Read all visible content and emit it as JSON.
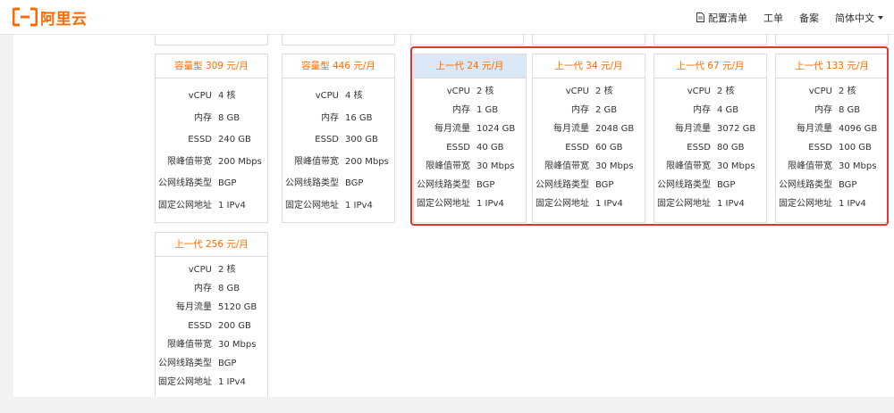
{
  "brand": {
    "logo_text": "阿里云"
  },
  "nav": {
    "config_list": "配置清单",
    "tickets": "工单",
    "filing": "备案",
    "language": "简体中文"
  },
  "cards": [
    {
      "title": "容量型 309 元/月",
      "rows": [
        {
          "k": "vCPU",
          "v": "4 核"
        },
        {
          "k": "内存",
          "v": "8 GB"
        },
        {
          "k": "ESSD",
          "v": "240 GB"
        },
        {
          "k": "限峰值带宽",
          "v": "200 Mbps"
        },
        {
          "k": "公网线路类型",
          "v": "BGP"
        },
        {
          "k": "固定公网地址",
          "v": "1 IPv4"
        }
      ]
    },
    {
      "title": "容量型 446 元/月",
      "rows": [
        {
          "k": "vCPU",
          "v": "4 核"
        },
        {
          "k": "内存",
          "v": "16 GB"
        },
        {
          "k": "ESSD",
          "v": "300 GB"
        },
        {
          "k": "限峰值带宽",
          "v": "200 Mbps"
        },
        {
          "k": "公网线路类型",
          "v": "BGP"
        },
        {
          "k": "固定公网地址",
          "v": "1 IPv4"
        }
      ]
    },
    {
      "title": "上一代 24 元/月",
      "rows": [
        {
          "k": "vCPU",
          "v": "2 核"
        },
        {
          "k": "内存",
          "v": "1 GB"
        },
        {
          "k": "每月流量",
          "v": "1024 GB"
        },
        {
          "k": "ESSD",
          "v": "40 GB"
        },
        {
          "k": "限峰值带宽",
          "v": "30 Mbps"
        },
        {
          "k": "公网线路类型",
          "v": "BGP"
        },
        {
          "k": "固定公网地址",
          "v": "1 IPv4"
        }
      ]
    },
    {
      "title": "上一代 34 元/月",
      "rows": [
        {
          "k": "vCPU",
          "v": "2 核"
        },
        {
          "k": "内存",
          "v": "2 GB"
        },
        {
          "k": "每月流量",
          "v": "2048 GB"
        },
        {
          "k": "ESSD",
          "v": "60 GB"
        },
        {
          "k": "限峰值带宽",
          "v": "30 Mbps"
        },
        {
          "k": "公网线路类型",
          "v": "BGP"
        },
        {
          "k": "固定公网地址",
          "v": "1 IPv4"
        }
      ]
    },
    {
      "title": "上一代 67 元/月",
      "rows": [
        {
          "k": "vCPU",
          "v": "2 核"
        },
        {
          "k": "内存",
          "v": "4 GB"
        },
        {
          "k": "每月流量",
          "v": "3072 GB"
        },
        {
          "k": "ESSD",
          "v": "80 GB"
        },
        {
          "k": "限峰值带宽",
          "v": "30 Mbps"
        },
        {
          "k": "公网线路类型",
          "v": "BGP"
        },
        {
          "k": "固定公网地址",
          "v": "1 IPv4"
        }
      ]
    },
    {
      "title": "上一代 133 元/月",
      "rows": [
        {
          "k": "vCPU",
          "v": "2 核"
        },
        {
          "k": "内存",
          "v": "8 GB"
        },
        {
          "k": "每月流量",
          "v": "4096 GB"
        },
        {
          "k": "ESSD",
          "v": "100 GB"
        },
        {
          "k": "限峰值带宽",
          "v": "30 Mbps"
        },
        {
          "k": "公网线路类型",
          "v": "BGP"
        },
        {
          "k": "固定公网地址",
          "v": "1 IPv4"
        }
      ]
    },
    {
      "title": "上一代 256 元/月",
      "rows": [
        {
          "k": "vCPU",
          "v": "2 核"
        },
        {
          "k": "内存",
          "v": "8 GB"
        },
        {
          "k": "每月流量",
          "v": "5120 GB"
        },
        {
          "k": "ESSD",
          "v": "200 GB"
        },
        {
          "k": "限峰值带宽",
          "v": "30 Mbps"
        },
        {
          "k": "公网线路类型",
          "v": "BGP"
        },
        {
          "k": "固定公网地址",
          "v": "1 IPv4"
        }
      ]
    }
  ],
  "colors": {
    "brand": "#ff6a00",
    "selected_header": "#dbe8f7",
    "highlight": "#e8322c"
  }
}
